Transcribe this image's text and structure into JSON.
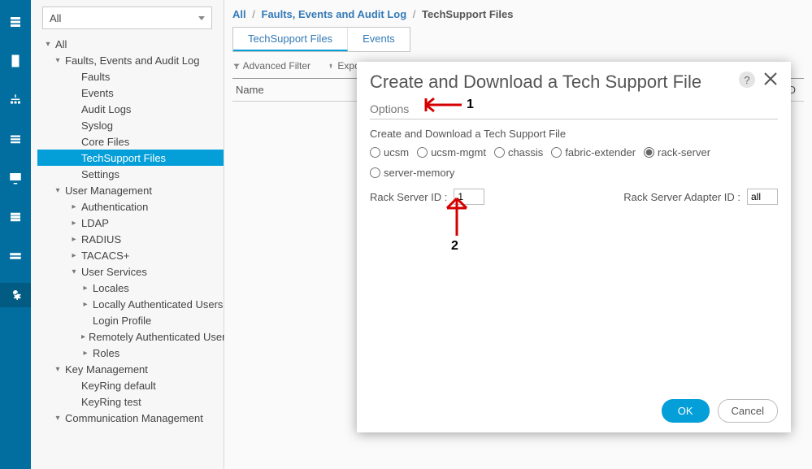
{
  "dropdown_value": "All",
  "breadcrumbs": {
    "c1": "All",
    "c2": "Faults, Events and Audit Log",
    "c3": "TechSupport Files"
  },
  "tabs": {
    "t1": "TechSupport Files",
    "t2": "Events"
  },
  "filter_bar": {
    "adv": "Advanced Filter",
    "exp": "Export"
  },
  "columns": {
    "name": "Name",
    "remain": "ric ID"
  },
  "tree": [
    {
      "depth": 0,
      "arr": "open",
      "lbl": "All",
      "sel": false
    },
    {
      "depth": 1,
      "arr": "open",
      "lbl": "Faults, Events and Audit Log",
      "sel": false
    },
    {
      "depth": 2,
      "arr": "none",
      "lbl": "Faults",
      "sel": false
    },
    {
      "depth": 2,
      "arr": "none",
      "lbl": "Events",
      "sel": false
    },
    {
      "depth": 2,
      "arr": "none",
      "lbl": "Audit Logs",
      "sel": false
    },
    {
      "depth": 2,
      "arr": "none",
      "lbl": "Syslog",
      "sel": false
    },
    {
      "depth": 2,
      "arr": "none",
      "lbl": "Core Files",
      "sel": false
    },
    {
      "depth": 2,
      "arr": "none",
      "lbl": "TechSupport Files",
      "sel": true
    },
    {
      "depth": 2,
      "arr": "none",
      "lbl": "Settings",
      "sel": false
    },
    {
      "depth": 1,
      "arr": "open",
      "lbl": "User Management",
      "sel": false
    },
    {
      "depth": 2,
      "arr": "closed",
      "lbl": "Authentication",
      "sel": false
    },
    {
      "depth": 2,
      "arr": "closed",
      "lbl": "LDAP",
      "sel": false
    },
    {
      "depth": 2,
      "arr": "closed",
      "lbl": "RADIUS",
      "sel": false
    },
    {
      "depth": 2,
      "arr": "closed",
      "lbl": "TACACS+",
      "sel": false
    },
    {
      "depth": 2,
      "arr": "open",
      "lbl": "User Services",
      "sel": false
    },
    {
      "depth": 3,
      "arr": "closed",
      "lbl": "Locales",
      "sel": false
    },
    {
      "depth": 3,
      "arr": "closed",
      "lbl": "Locally Authenticated Users",
      "sel": false
    },
    {
      "depth": 3,
      "arr": "none",
      "lbl": "Login Profile",
      "sel": false
    },
    {
      "depth": 3,
      "arr": "closed",
      "lbl": "Remotely Authenticated Users",
      "sel": false
    },
    {
      "depth": 3,
      "arr": "closed",
      "lbl": "Roles",
      "sel": false
    },
    {
      "depth": 1,
      "arr": "open",
      "lbl": "Key Management",
      "sel": false
    },
    {
      "depth": 2,
      "arr": "none",
      "lbl": "KeyRing default",
      "sel": false
    },
    {
      "depth": 2,
      "arr": "none",
      "lbl": "KeyRing test",
      "sel": false
    },
    {
      "depth": 1,
      "arr": "open",
      "lbl": "Communication Management",
      "sel": false
    }
  ],
  "modal": {
    "title": "Create and Download a Tech Support File",
    "options_header": "Options",
    "body_line": "Create and Download a Tech Support File",
    "radios": {
      "r1": "ucsm",
      "r2": "ucsm-mgmt",
      "r3": "chassis",
      "r4": "fabric-extender",
      "r5": "rack-server",
      "r6": "server-memory"
    },
    "field1_label": "Rack Server ID :",
    "field1_value": "1",
    "field2_label": "Rack Server Adapter ID :",
    "field2_value": "all",
    "ok": "OK",
    "cancel": "Cancel",
    "help": "?"
  },
  "annotations": {
    "n1": "1",
    "n2": "2"
  }
}
